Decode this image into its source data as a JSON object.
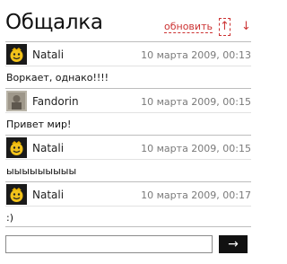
{
  "header": {
    "title": "Общалка",
    "refresh_label": "обновить",
    "up_arrow": "↑",
    "down_arrow": "↓"
  },
  "messages": [
    {
      "author": "Natali",
      "time": "10 марта 2009, 00:13",
      "text": "Воркает, однако!!!!",
      "avatar": "smiley-avatar-icon"
    },
    {
      "author": "Fandorin",
      "time": "10 марта 2009, 00:15",
      "text": "Привет мир!",
      "avatar": "photo-avatar-icon"
    },
    {
      "author": "Natali",
      "time": "10 марта 2009, 00:15",
      "text": "ыыыыыыыыы",
      "avatar": "smiley-avatar-icon"
    },
    {
      "author": "Natali",
      "time": "10 марта 2009, 00:17",
      "text": ":)",
      "avatar": "smiley-avatar-icon"
    }
  ],
  "composer": {
    "value": "",
    "send_label": "→"
  },
  "colors": {
    "accent": "#cc3333",
    "send_bg": "#111111"
  }
}
